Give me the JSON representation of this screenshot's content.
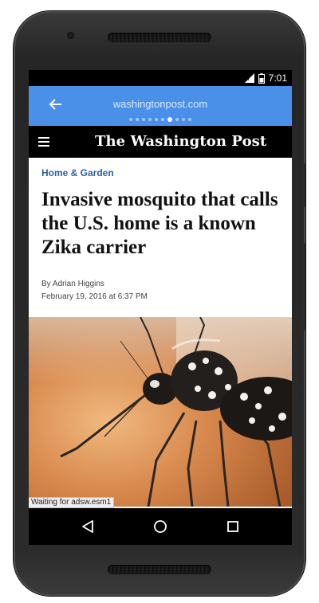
{
  "status_bar": {
    "time": "7:01",
    "icons": [
      "signal-icon",
      "battery-icon"
    ]
  },
  "browser": {
    "url": "washingtonpost.com",
    "back_icon": "back-arrow-icon",
    "page_dots_total": 10,
    "page_dots_active": 7
  },
  "masthead": {
    "logo": "The Washington Post",
    "menu_icon": "hamburger-menu-icon"
  },
  "article": {
    "section": "Home & Garden",
    "headline": "Invasive mosquito that calls the U.S. home is a known Zika carrier",
    "byline": "By Adrian Higgins",
    "date": "February 19, 2016 at 6:37 PM",
    "image_subject": "mosquito photo"
  },
  "loading_status": "Waiting for adsw.esm1",
  "nav_bar": {
    "buttons": [
      "back-triangle-icon",
      "home-circle-icon",
      "recents-square-icon"
    ]
  },
  "colors": {
    "url_bar": "#4a90e9",
    "section_label": "#2a5fa6",
    "masthead": "#000000"
  }
}
